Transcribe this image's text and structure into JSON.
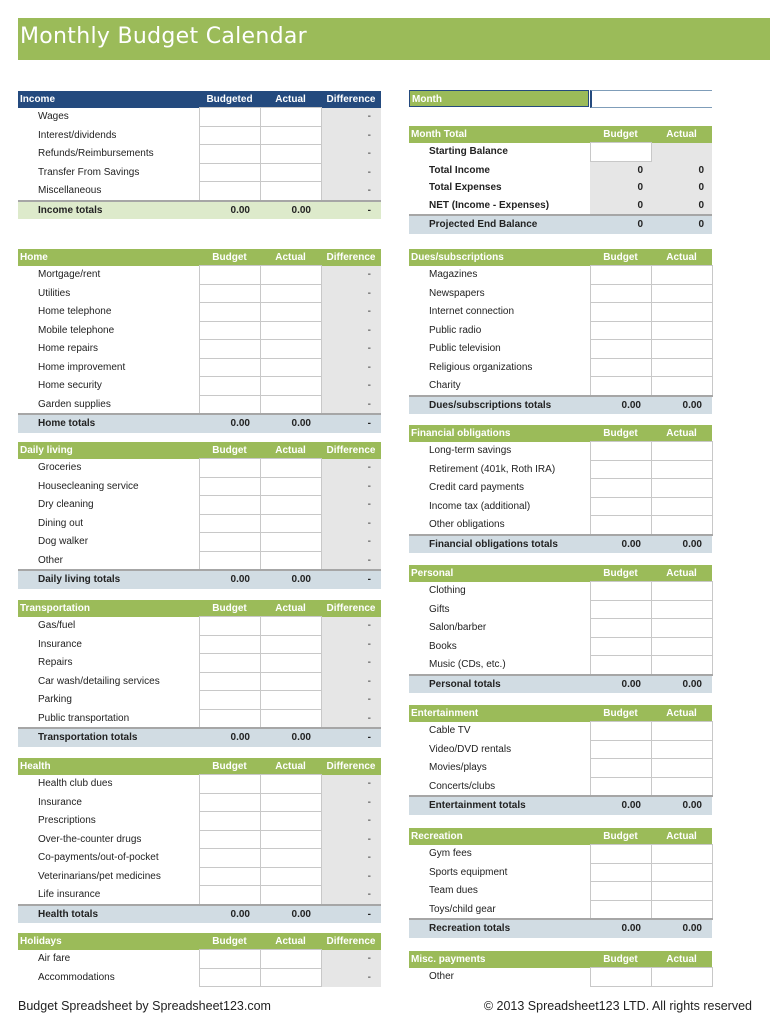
{
  "title": "Monthly Budget Calendar",
  "month": {
    "label": "Month",
    "value": ""
  },
  "income": {
    "header": [
      "Income",
      "Budgeted",
      "Actual",
      "Difference"
    ],
    "items": [
      "Wages",
      "Interest/dividends",
      "Refunds/Reimbursements",
      "Transfer From Savings",
      "Miscellaneous"
    ],
    "diff": "-",
    "totals": {
      "label": "Income totals",
      "budget": "0.00",
      "actual": "0.00",
      "diff": "-"
    }
  },
  "summary": {
    "header": [
      "Month Total",
      "Budget",
      "Actual"
    ],
    "rows": [
      {
        "label": "Starting Balance",
        "budget": "",
        "actual": ""
      },
      {
        "label": "Total Income",
        "budget": "0",
        "actual": "0"
      },
      {
        "label": "Total Expenses",
        "budget": "0",
        "actual": "0"
      },
      {
        "label": "NET (Income - Expenses)",
        "budget": "0",
        "actual": "0"
      }
    ],
    "total": {
      "label": "Projected End Balance",
      "budget": "0",
      "actual": "0"
    }
  },
  "home": {
    "header": [
      "Home",
      "Budget",
      "Actual",
      "Difference"
    ],
    "items": [
      "Mortgage/rent",
      "Utilities",
      "Home telephone",
      "Mobile telephone",
      "Home repairs",
      "Home improvement",
      "Home security",
      "Garden supplies"
    ],
    "diff": "-",
    "totals": {
      "label": "Home totals",
      "budget": "0.00",
      "actual": "0.00",
      "diff": "-"
    }
  },
  "daily": {
    "header": [
      "Daily living",
      "Budget",
      "Actual",
      "Difference"
    ],
    "items": [
      "Groceries",
      "Housecleaning service",
      "Dry cleaning",
      "Dining out",
      "Dog walker",
      "Other"
    ],
    "diff": "-",
    "totals": {
      "label": "Daily living totals",
      "budget": "0.00",
      "actual": "0.00",
      "diff": "-"
    }
  },
  "transport": {
    "header": [
      "Transportation",
      "Budget",
      "Actual",
      "Difference"
    ],
    "items": [
      "Gas/fuel",
      "Insurance",
      "Repairs",
      "Car wash/detailing services",
      "Parking",
      "Public transportation"
    ],
    "diff": "-",
    "totals": {
      "label": "Transportation totals",
      "budget": "0.00",
      "actual": "0.00",
      "diff": "-"
    }
  },
  "health": {
    "header": [
      "Health",
      "Budget",
      "Actual",
      "Difference"
    ],
    "items": [
      "Health club dues",
      "Insurance",
      "Prescriptions",
      "Over-the-counter drugs",
      "Co-payments/out-of-pocket",
      "Veterinarians/pet medicines",
      "Life insurance"
    ],
    "diff": "-",
    "totals": {
      "label": "Health totals",
      "budget": "0.00",
      "actual": "0.00",
      "diff": "-"
    }
  },
  "holidays": {
    "header": [
      "Holidays",
      "Budget",
      "Actual",
      "Difference"
    ],
    "items": [
      "Air fare",
      "Accommodations"
    ],
    "diff": "-"
  },
  "dues": {
    "header": [
      "Dues/subscriptions",
      "Budget",
      "Actual"
    ],
    "items": [
      "Magazines",
      "Newspapers",
      "Internet connection",
      "Public radio",
      "Public television",
      "Religious organizations",
      "Charity"
    ],
    "totals": {
      "label": "Dues/subscriptions totals",
      "budget": "0.00",
      "actual": "0.00"
    }
  },
  "financial": {
    "header": [
      "Financial obligations",
      "Budget",
      "Actual"
    ],
    "items": [
      "Long-term savings",
      "Retirement (401k, Roth IRA)",
      "Credit card payments",
      "Income tax (additional)",
      "Other obligations"
    ],
    "totals": {
      "label": "Financial obligations totals",
      "budget": "0.00",
      "actual": "0.00"
    }
  },
  "personal": {
    "header": [
      "Personal",
      "Budget",
      "Actual"
    ],
    "items": [
      "Clothing",
      "Gifts",
      "Salon/barber",
      "Books",
      "Music (CDs, etc.)"
    ],
    "totals": {
      "label": "Personal totals",
      "budget": "0.00",
      "actual": "0.00"
    }
  },
  "entertainment": {
    "header": [
      "Entertainment",
      "Budget",
      "Actual"
    ],
    "items": [
      "Cable TV",
      "Video/DVD rentals",
      "Movies/plays",
      "Concerts/clubs"
    ],
    "totals": {
      "label": "Entertainment totals",
      "budget": "0.00",
      "actual": "0.00"
    }
  },
  "recreation": {
    "header": [
      "Recreation",
      "Budget",
      "Actual"
    ],
    "items": [
      "Gym fees",
      "Sports equipment",
      "Team dues",
      "Toys/child gear"
    ],
    "totals": {
      "label": "Recreation totals",
      "budget": "0.00",
      "actual": "0.00"
    }
  },
  "misc": {
    "header": [
      "Misc. payments",
      "Budget",
      "Actual"
    ],
    "items": [
      "Other"
    ]
  },
  "footer": {
    "left": "Budget Spreadsheet by Spreadsheet123.com",
    "right": "© 2013 Spreadsheet123 LTD. All rights reserved"
  }
}
